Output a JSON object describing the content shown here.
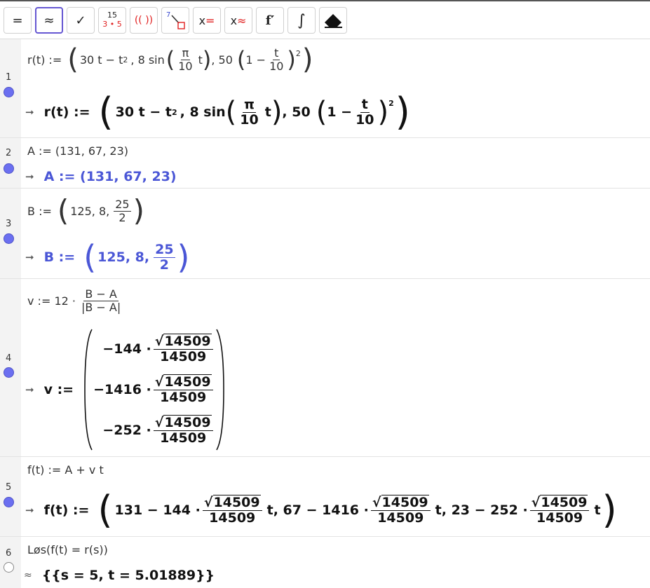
{
  "toolbar": {
    "exact": "=",
    "numeric": "≈",
    "check": "✓",
    "factor_top": "15",
    "factor_bottom": "3 • 5",
    "expand": "(( ))",
    "substitute_num": "7",
    "solve_x": "x",
    "solve_eq": "=",
    "nsolve_x": "x",
    "nsolve_eq": "≈",
    "derivative": "f′",
    "integral": "∫",
    "delete": "eraser"
  },
  "rows": [
    {
      "number": "1",
      "input": {
        "lhs": "r(t) :=",
        "a": "30 t − t",
        "pow": "2",
        "sep": ", 8 sin",
        "pi": "π",
        "ten": "10",
        "t": "t",
        "c": ", 50",
        "one": "1 −",
        "tt": "t",
        "pw2": "2"
      },
      "output": {
        "lhs": "r(t) :=",
        "a": "30 t − t",
        "pow": "2",
        "sep": ", 8 sin",
        "pi": "π",
        "ten": "10",
        "t": "t",
        "c": ", 50",
        "one": "1 −",
        "tt": "t",
        "pw2": "2"
      }
    },
    {
      "number": "2",
      "input": "A := (131, 67, 23)",
      "output": "A := (131, 67, 23)"
    },
    {
      "number": "3",
      "input": {
        "lhs": "B :=",
        "vals": "125, 8,",
        "num": "25",
        "den": "2"
      },
      "output": {
        "lhs": "B :=",
        "vals": "125, 8,",
        "num": "25",
        "den": "2"
      }
    },
    {
      "number": "4",
      "input": {
        "lhs": "v := 12 ·",
        "num": "B − A",
        "den": "|B − A|"
      },
      "output": {
        "lhs": "v :=",
        "c1": "−144 ·",
        "c2": "−1416 ·",
        "c3": "−252 ·",
        "sqrt": "14509",
        "den": "14509"
      }
    },
    {
      "number": "5",
      "input": "f(t) := A + v t",
      "output": {
        "lhs": "f(t) :=",
        "p1": "131 − 144 ·",
        "p2": ", 67 − 1416 ·",
        "p3": ", 23 − 252 ·",
        "sqrt": "14509",
        "den": "14509",
        "t": "t"
      }
    },
    {
      "number": "6",
      "input": "Løs(f(t) = r(s))",
      "approx": "≈",
      "output": "{{s = 5, t = 5.01889}}"
    }
  ]
}
